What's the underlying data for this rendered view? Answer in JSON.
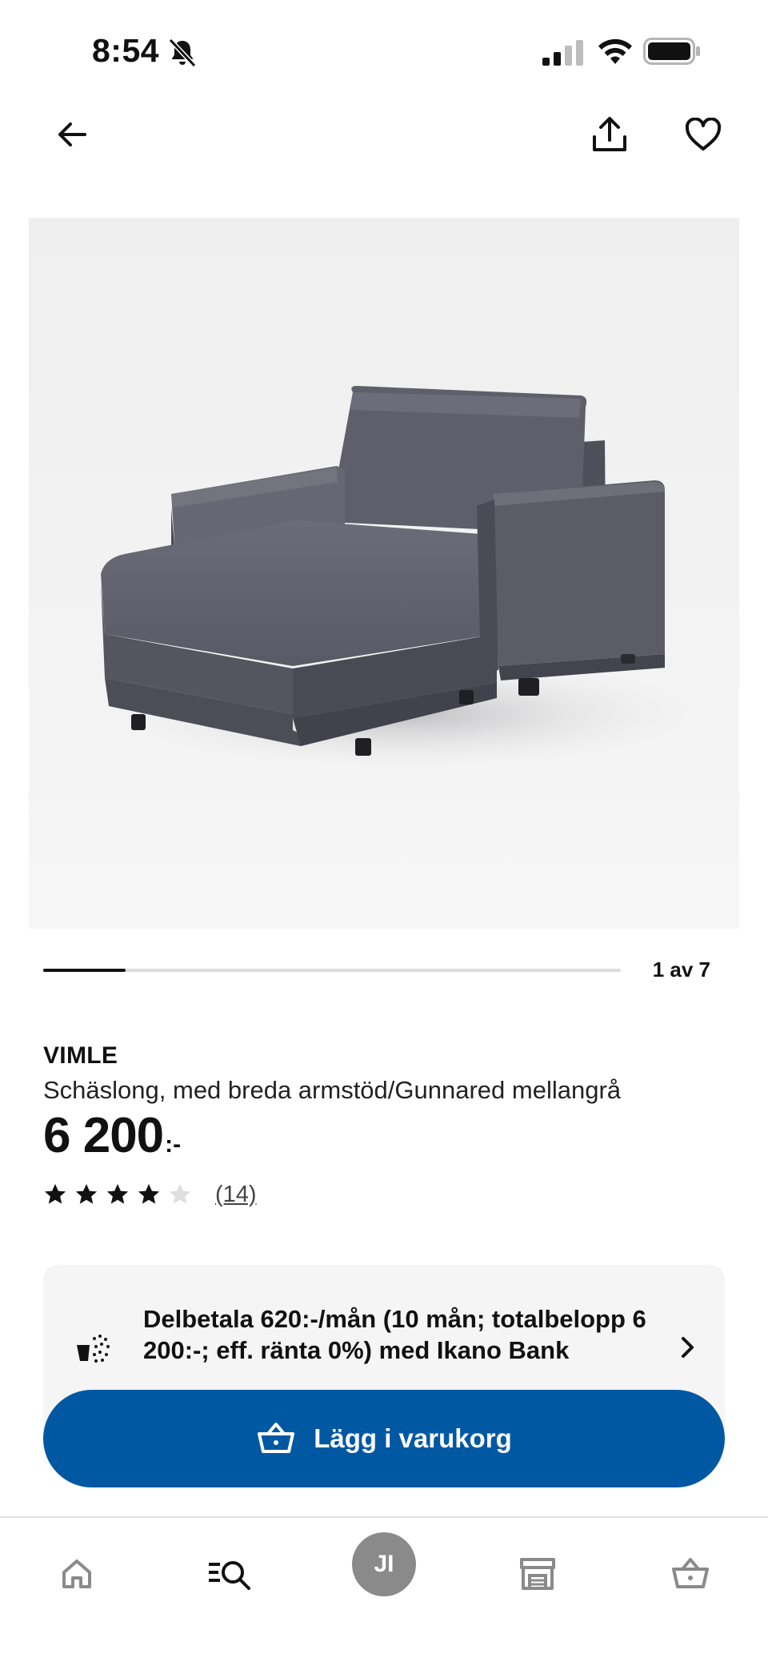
{
  "status_bar": {
    "time": "8:54"
  },
  "carousel": {
    "counter": "1 av 7",
    "current": 1,
    "total": 7
  },
  "product": {
    "name": "VIMLE",
    "description": "Schäslong, med breda armstöd/Gunnared mellangrå",
    "price": "6 200",
    "price_suffix": ":-",
    "rating": {
      "value": 4,
      "max": 5,
      "count_label": "(14)"
    }
  },
  "financing": {
    "text": "Delbetala 620:-/mån (10 mån; totalbelopp 6 200:-; eff. ränta 0%) med Ikano Bank"
  },
  "cta": {
    "add_to_cart_label": "Lägg i varukorg"
  },
  "bottom_nav": {
    "profile_initials": "JI"
  },
  "icons": {
    "back": "arrow-left-icon",
    "share": "share-icon",
    "favorite": "heart-icon",
    "finance": "basket-installments-icon",
    "cart": "shopping-basket-icon",
    "home": "home-icon",
    "search": "search-icon",
    "stores": "store-icon",
    "chevron": "chevron-right-icon"
  },
  "colors": {
    "primary_blue": "#0058a3",
    "text": "#111111",
    "card_bg": "#f5f5f5"
  }
}
